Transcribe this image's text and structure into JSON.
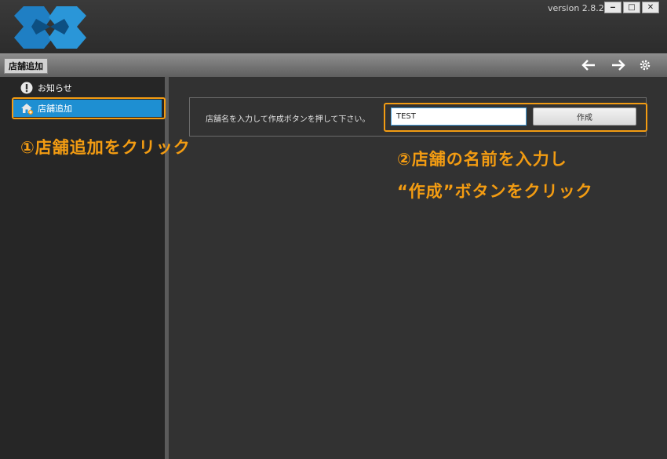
{
  "window": {
    "version": "version 2.8.2",
    "buttons": [
      "‒",
      "□",
      "✕"
    ]
  },
  "toolbar": {
    "page_title": "店舗追加",
    "back_icon": "arrow-left-icon",
    "forward_icon": "arrow-right-icon",
    "settings_icon": "gear-icon"
  },
  "sidebar": {
    "items": [
      {
        "label": "お知らせ",
        "icon": "exclamation-icon",
        "active": false
      },
      {
        "label": "店舗追加",
        "icon": "home-add-icon",
        "active": true
      }
    ]
  },
  "form": {
    "instruction": "店舗名を入力して作成ボタンを押して下さい。",
    "store_name_value": "TEST",
    "create_label": "作成"
  },
  "annotations": {
    "step1": "①店舗追加をクリック",
    "step2_line1": "②店舗の名前を入力し",
    "step2_line2": "“作成”ボタンをクリック"
  },
  "colors": {
    "accent": "#f39c12",
    "active_item": "#1e8fd2",
    "background": "#323232"
  }
}
